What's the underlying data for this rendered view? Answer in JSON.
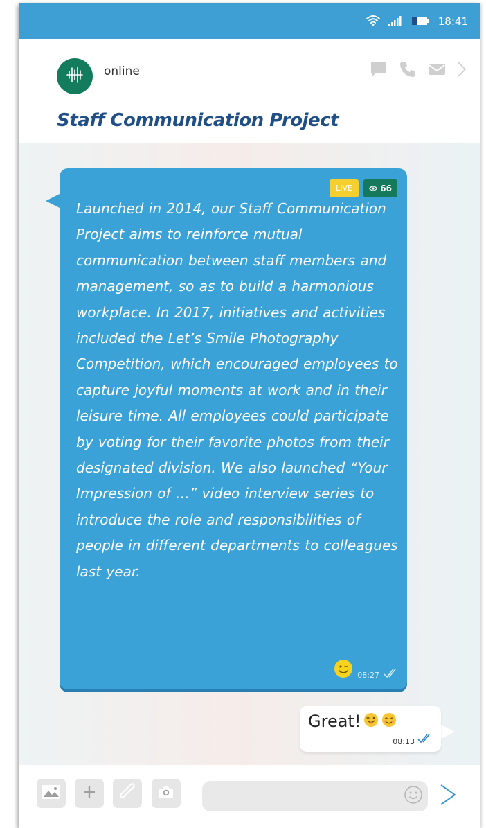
{
  "status_bar": {
    "time": "18:41",
    "icons": [
      "wifi-icon",
      "signal-icon",
      "battery-icon"
    ]
  },
  "header": {
    "status_text": "online",
    "title": "Staff Communication Project",
    "actions": [
      "chat-icon",
      "phone-icon",
      "mail-icon",
      "chevron-right-icon"
    ],
    "avatar_color": "#127c5d"
  },
  "messages": [
    {
      "direction": "incoming",
      "badges": {
        "live": "LIVE",
        "views": "66"
      },
      "text": "Launched in 2014, our Staff Communication Project aims to reinforce mutual communication between staff members and management, so as to build a harmonious workplace. In 2017, initiatives and activities included the Let’s Smile Photography Competition, which encouraged employees to capture joyful moments at work and in their leisure time. All employees could participate by voting for their favorite photos from their designated division. We also launched “Your Impression of …” video interview series to introduce the role and responsibilities of people in different departments to colleagues last year.",
      "reaction": "winking-face-emoji",
      "time": "08:27",
      "read_icon": "double-check-icon"
    },
    {
      "direction": "outgoing",
      "text": "Great!",
      "emojis": [
        "tongue-out-emoji",
        "smiling-face-emoji"
      ],
      "time": "08:13",
      "read_icon": "double-check-icon"
    }
  ],
  "input_bar": {
    "tools": [
      "image-icon",
      "plus-icon",
      "paperclip-icon",
      "camera-icon"
    ],
    "message_value": "",
    "emoji_icon": "smiley-icon",
    "send_icon": "send-icon"
  },
  "colors": {
    "status_bar": "#3d9fd4",
    "bubble_incoming": "#3ba2d7",
    "title": "#1f4f86",
    "badge_live": "#f5cf2f",
    "badge_views": "#147a5b",
    "read_check_outgoing": "#2a7fc0"
  }
}
